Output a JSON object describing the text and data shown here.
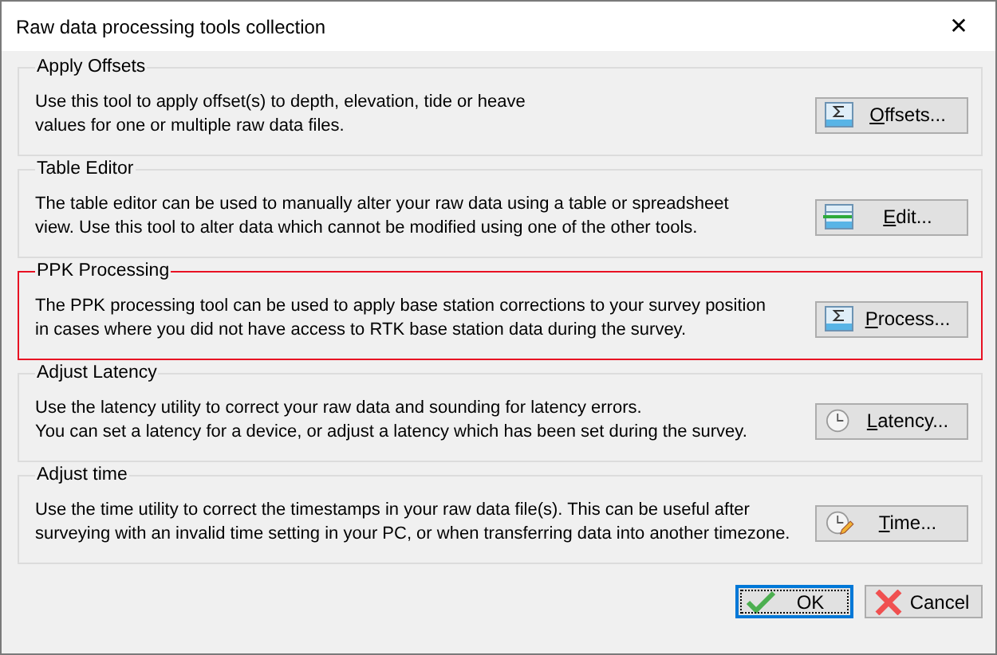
{
  "window": {
    "title": "Raw data processing tools collection",
    "close": "✕"
  },
  "sections": [
    {
      "title": "Apply Offsets",
      "description": "Use this tool to apply offset(s) to depth, elevation, tide or heave\nvalues for one or multiple raw data files.",
      "highlighted": false,
      "button": {
        "label": "Offsets...",
        "kind": "sigma",
        "mnemonic": true
      }
    },
    {
      "title": "Table Editor",
      "description": "The table editor can be used to manually alter your raw data using a table or spreadsheet\nview. Use this tool to alter data which cannot be modified using one of the other tools.",
      "highlighted": false,
      "button": {
        "label": "Edit...",
        "kind": "table",
        "mnemonic": true
      }
    },
    {
      "title": "PPK Processing",
      "description": "The PPK processing tool can be used to apply base station corrections to your survey position\nin cases where you did not have access to RTK base station data during the survey.",
      "highlighted": true,
      "button": {
        "label": "Process...",
        "kind": "sigma",
        "mnemonic": true
      }
    },
    {
      "title": "Adjust Latency",
      "description": "Use the latency utility to correct your raw data and sounding for latency errors.\nYou can set a latency for a device, or adjust a latency which has been set during the survey.",
      "highlighted": false,
      "button": {
        "label": "Latency...",
        "kind": "clock",
        "mnemonic": true
      }
    },
    {
      "title": "Adjust time",
      "description": "Use the time utility to correct the timestamps in your raw data file(s). This can be useful after\nsurveying with an invalid time setting in your PC, or when transferring data into another timezone.",
      "highlighted": false,
      "button": {
        "label": "Time...",
        "kind": "clock-pencil",
        "mnemonic": true
      }
    }
  ],
  "footer": [
    {
      "label": "OK",
      "kind": "ok",
      "focused": true
    },
    {
      "label": "Cancel",
      "kind": "cancel",
      "focused": false
    }
  ]
}
